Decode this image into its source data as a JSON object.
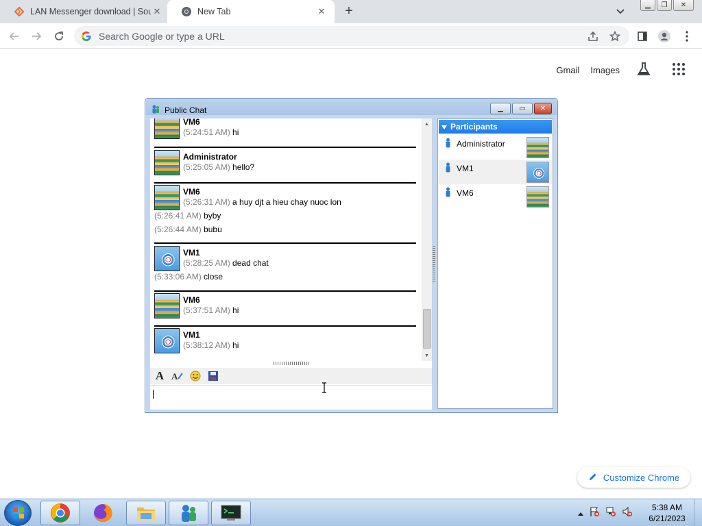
{
  "browser": {
    "tabs": [
      {
        "title": "LAN Messenger download | Sour",
        "active": false
      },
      {
        "title": "New Tab",
        "active": true
      }
    ],
    "omnibox_placeholder": "Search Google or type a URL",
    "ntp_links": {
      "gmail": "Gmail",
      "images": "Images"
    },
    "customize_label": "Customize Chrome",
    "accent_color": "#1a73e8"
  },
  "lan_window": {
    "title": "Public Chat",
    "participants_header": "Participants",
    "participants": [
      {
        "name": "Administrator",
        "avatar": "stairs"
      },
      {
        "name": "VM1",
        "avatar": "wheel"
      },
      {
        "name": "VM6",
        "avatar": "stairs"
      }
    ],
    "messages": [
      {
        "sender": "VM6",
        "avatar": "stairs",
        "lines": [
          {
            "time": "(5:24:51 AM)",
            "text": "hi"
          }
        ]
      },
      {
        "sender": "Administrator",
        "avatar": "stairs",
        "lines": [
          {
            "time": "(5:25:05 AM)",
            "text": "hello?"
          }
        ]
      },
      {
        "sender": "VM6",
        "avatar": "stairs",
        "lines": [
          {
            "time": "(5:26:31 AM)",
            "text": "a huy djt a hieu chay nuoc lon"
          },
          {
            "time": "(5:26:41 AM)",
            "text": "byby"
          },
          {
            "time": "(5:26:44 AM)",
            "text": "bubu"
          }
        ]
      },
      {
        "sender": "VM1",
        "avatar": "wheel",
        "lines": [
          {
            "time": "(5:28:25 AM)",
            "text": "dead chat"
          },
          {
            "time": "(5:33:06 AM)",
            "text": "close"
          }
        ]
      },
      {
        "sender": "VM6",
        "avatar": "stairs",
        "lines": [
          {
            "time": "(5:37:51 AM)",
            "text": "hi"
          }
        ]
      },
      {
        "sender": "VM1",
        "avatar": "wheel",
        "lines": [
          {
            "time": "(5:38:12 AM)",
            "text": "hi"
          }
        ]
      }
    ],
    "input_value": ""
  },
  "taskbar": {
    "apps": [
      "chrome-icon",
      "firefox-icon",
      "explorer-icon",
      "lan-messenger-icon",
      "terminal-icon"
    ],
    "clock_time": "5:38 AM",
    "clock_date": "6/21/2023"
  }
}
